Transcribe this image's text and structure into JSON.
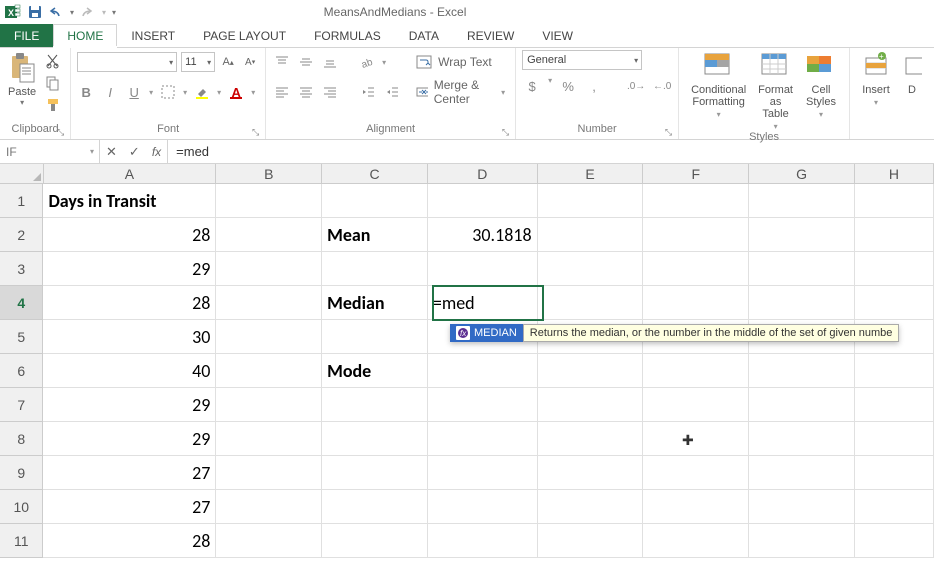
{
  "title": "MeansAndMedians - Excel",
  "tabs": {
    "file": "FILE",
    "home": "HOME",
    "insert": "INSERT",
    "page_layout": "PAGE LAYOUT",
    "formulas": "FORMULAS",
    "data": "DATA",
    "review": "REVIEW",
    "view": "VIEW"
  },
  "ribbon": {
    "clipboard": {
      "paste": "Paste",
      "label": "Clipboard"
    },
    "font": {
      "size": "11",
      "label": "Font",
      "bold": "B",
      "italic": "I",
      "underline": "U"
    },
    "alignment": {
      "wrap": "Wrap Text",
      "merge": "Merge & Center",
      "label": "Alignment"
    },
    "number": {
      "format": "General",
      "label": "Number"
    },
    "styles": {
      "cond": "Conditional\nFormatting",
      "table": "Format as\nTable",
      "cell": "Cell\nStyles",
      "label": "Styles"
    },
    "cells": {
      "insert": "Insert",
      "delete": "D"
    }
  },
  "name_box": "IF",
  "formula": "=med",
  "columns": [
    "A",
    "B",
    "C",
    "D",
    "E",
    "F",
    "G",
    "H"
  ],
  "rows": {
    "r1": {
      "A": "Days in Transit"
    },
    "r2": {
      "A": "28",
      "C": "Mean",
      "D": "30.1818"
    },
    "r3": {
      "A": "29"
    },
    "r4": {
      "A": "28",
      "C": "Median",
      "D": "=med"
    },
    "r5": {
      "A": "30"
    },
    "r6": {
      "A": "40",
      "C": "Mode"
    },
    "r7": {
      "A": "29"
    },
    "r8": {
      "A": "29"
    },
    "r9": {
      "A": "27"
    },
    "r10": {
      "A": "27"
    },
    "r11": {
      "A": "28"
    }
  },
  "autocomplete": {
    "name": "MEDIAN",
    "desc": "Returns the median, or the number in the middle of the set of given numbe"
  }
}
